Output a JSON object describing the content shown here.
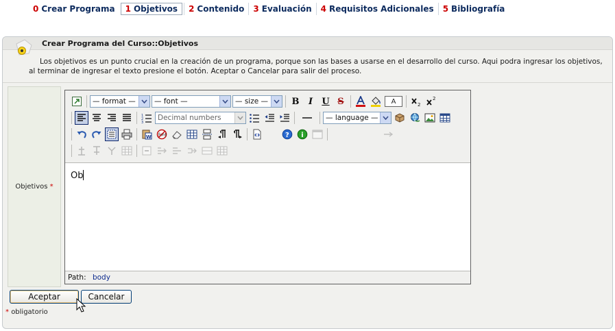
{
  "tabs": [
    {
      "num": "0",
      "label": "Crear Programa"
    },
    {
      "num": "1",
      "label": "Objetivos",
      "active": true
    },
    {
      "num": "2",
      "label": "Contenido"
    },
    {
      "num": "3",
      "label": "Evaluación"
    },
    {
      "num": "4",
      "label": "Requisitos Adicionales"
    },
    {
      "num": "5",
      "label": "Bibliografía"
    }
  ],
  "panel": {
    "title": "Crear Programa del Curso::Objetivos",
    "description": "Los objetivos es un punto crucial en la creación de un programa, porque son las bases a usarse en el desarrollo del curso. Aqui podra ingresar los objetivos, al terminar de ingresar el texto presione el botón. Aceptar o Cancelar para salir del proceso."
  },
  "form": {
    "field_label": "Objetivos",
    "required_mark": "*"
  },
  "editor": {
    "format_select": "— format —",
    "font_select": "— font —",
    "size_select": "— size —",
    "list_style_select": "Decimal numbers",
    "language_select": "— language —",
    "font_size_box": "A",
    "content_text": "Ob",
    "path_label": "Path:",
    "path_value": "body"
  },
  "buttons": {
    "accept": "Aceptar",
    "cancel": "Cancelar"
  },
  "footer": {
    "required_mark": "*",
    "required_text": "obligatorio"
  },
  "colors": {
    "tab_number": "#cc0000",
    "tab_label": "#0d2b5e",
    "panel_bg": "#f1f1ee",
    "label_cell_bg": "#ecefe6"
  }
}
